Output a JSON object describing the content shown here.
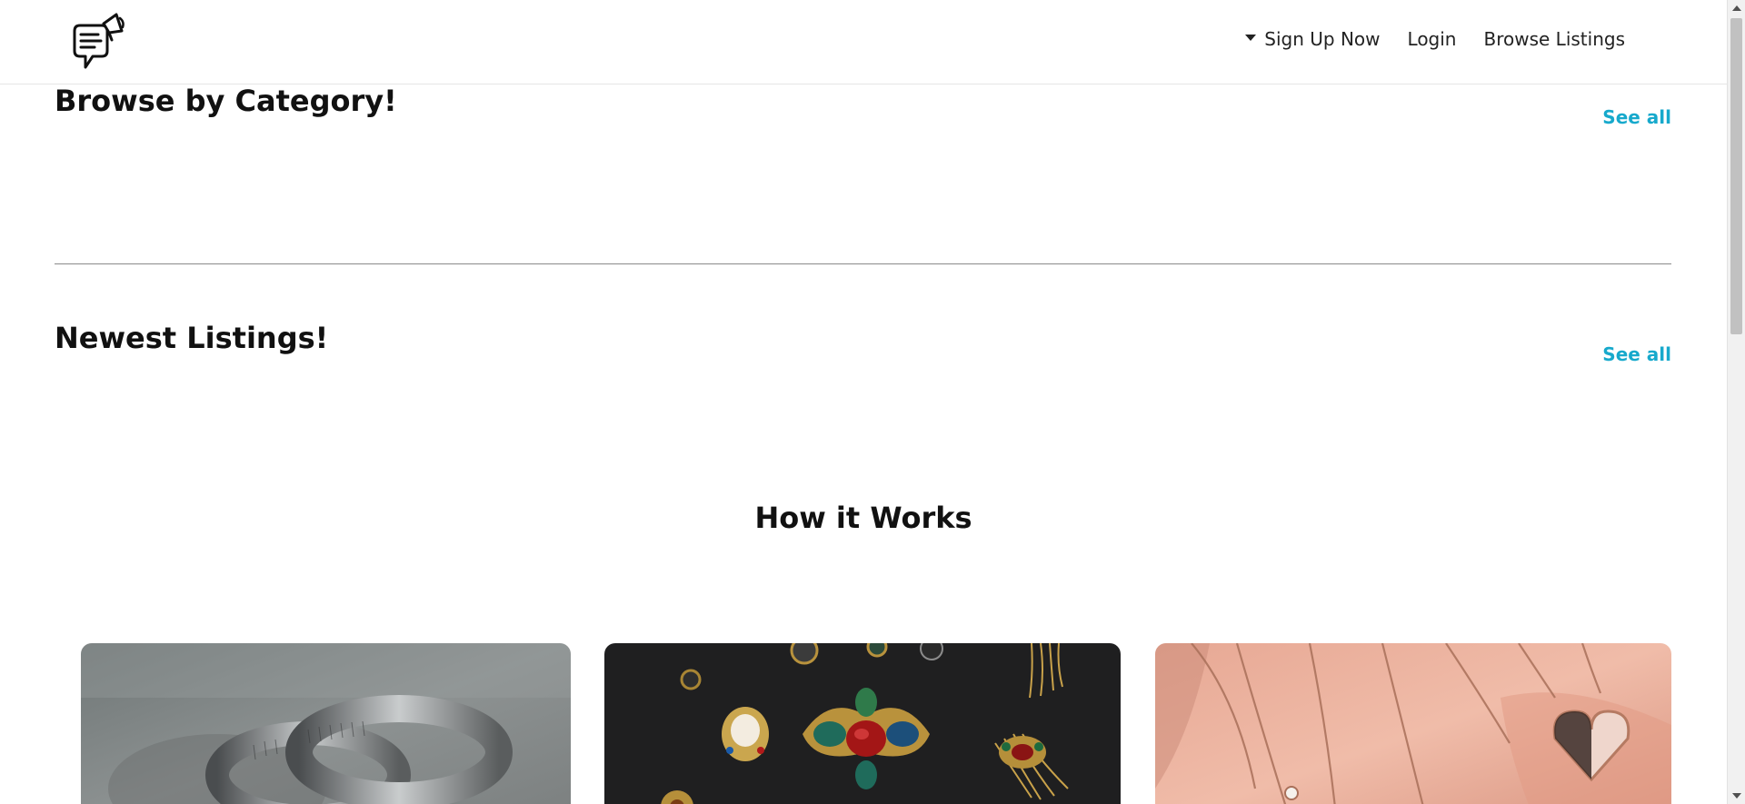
{
  "header": {
    "nav": {
      "signup_label": "Sign Up Now",
      "login_label": "Login",
      "browse_label": "Browse Listings"
    }
  },
  "sections": {
    "categories": {
      "title": "Browse by Category!",
      "see_all": "See all"
    },
    "newest": {
      "title": "Newest Listings!",
      "see_all": "See all"
    },
    "how_it_works": {
      "title": "How it Works"
    }
  },
  "cards": [
    {
      "image": "silver-rings-photo"
    },
    {
      "image": "vintage-brooches-photo"
    },
    {
      "image": "rose-gold-necklaces-photo"
    }
  ],
  "colors": {
    "accent": "#17a9cc",
    "text": "#111111",
    "divider": "#8a8a8a"
  }
}
